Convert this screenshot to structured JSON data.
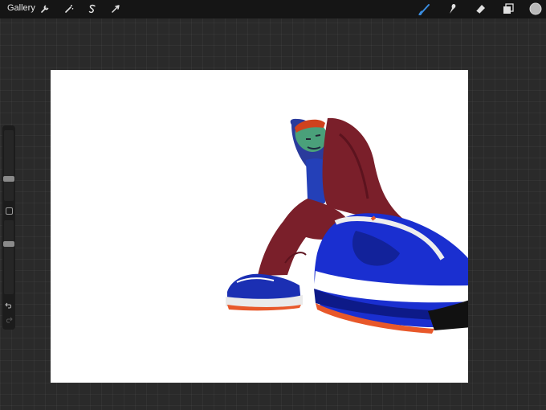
{
  "topbar": {
    "gallery_label": "Gallery",
    "left_tools": [
      "wrench-icon",
      "magic-wand-icon",
      "selection-icon",
      "transform-icon"
    ],
    "right_tools": [
      "brush-icon",
      "smudge-icon",
      "eraser-icon",
      "layers-icon",
      "color-icon"
    ],
    "active_tool": "brush",
    "current_color": "#b8b8b8"
  },
  "sidebar": {
    "brush_size_level": 0.3,
    "opacity_level": 0.7
  },
  "colors": {
    "toolbar_bg": "#151515",
    "accent": "#3a8de0",
    "canvas_bg": "#ffffff",
    "workspace_bg": "#2a2a2a"
  }
}
